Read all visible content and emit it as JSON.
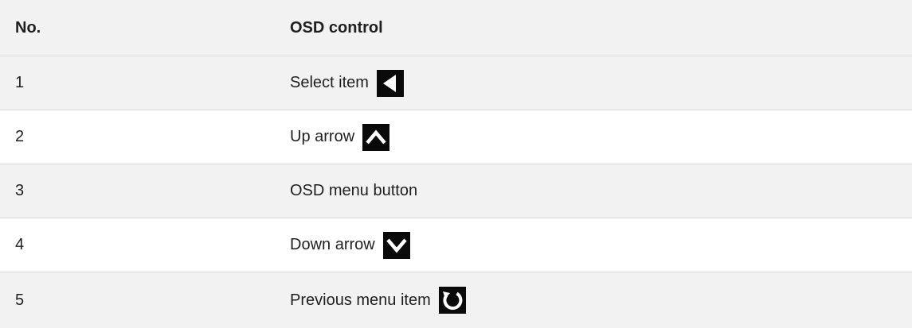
{
  "table": {
    "headers": {
      "no": "No.",
      "control": "OSD control"
    },
    "rows": [
      {
        "no": "1",
        "control": "Select item",
        "icon": "left-triangle-icon"
      },
      {
        "no": "2",
        "control": "Up arrow",
        "icon": "chevron-up-icon"
      },
      {
        "no": "3",
        "control": "OSD menu button",
        "icon": ""
      },
      {
        "no": "4",
        "control": "Down arrow",
        "icon": "chevron-down-icon"
      },
      {
        "no": "5",
        "control": "Previous menu item",
        "icon": "refresh-icon"
      }
    ]
  },
  "colors": {
    "header_bg": "#f2f2f2",
    "stripe_bg": "#f2f2f2",
    "icon_bg": "#0a0a0a",
    "icon_fg": "#ffffff"
  }
}
